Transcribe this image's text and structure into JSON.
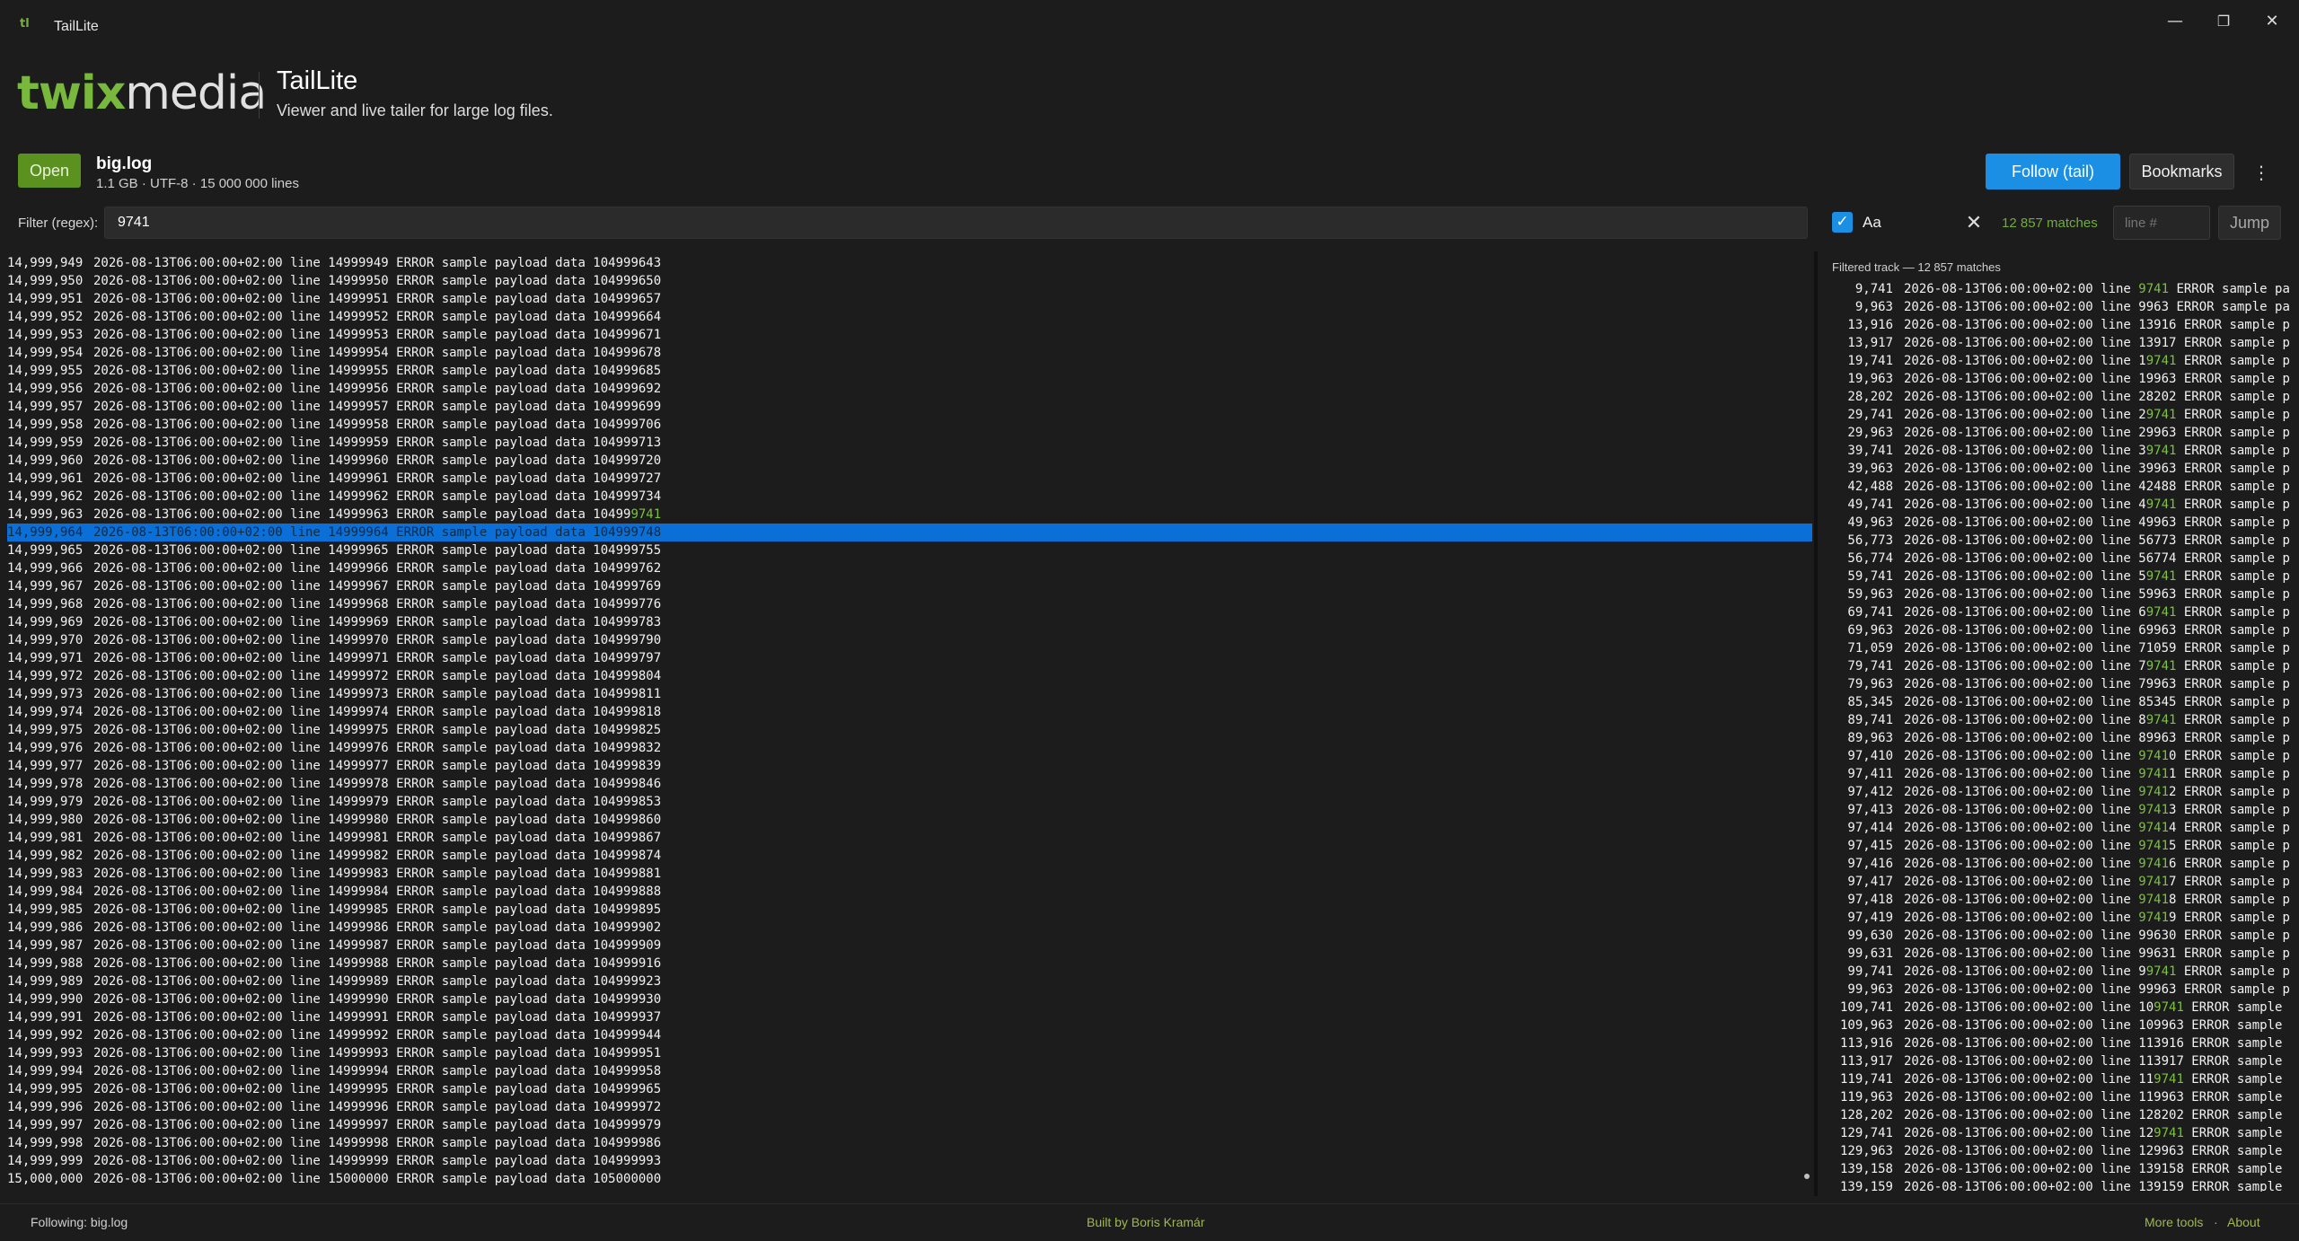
{
  "window": {
    "title": "TailLite",
    "app_icon_glyph": "tl",
    "minimize_glyph": "—",
    "restore_glyph": "❐",
    "close_glyph": "✕"
  },
  "header": {
    "logo_left": "twix",
    "logo_right": "media",
    "app_name": "TailLite",
    "tagline": "Viewer and live tailer for large log files."
  },
  "file": {
    "open_label": "Open",
    "name": "big.log",
    "meta": "1.1 GB · UTF-8 · 15 000 000 lines"
  },
  "toolbar": {
    "follow_label": "Follow (tail)",
    "bookmarks_label": "Bookmarks",
    "more_glyph": "⋮"
  },
  "filter": {
    "label": "Filter (regex):",
    "value": "9741",
    "case_label": "Aa",
    "case_checked": true,
    "clear_glyph": "✕",
    "match_count": "12 857 matches",
    "line_placeholder": "line #",
    "jump_label": "Jump"
  },
  "main_log": {
    "timestamp": "2026-08-13T06:00:00+02:00",
    "level": "ERROR",
    "selected_line": "14,999,964",
    "lines": [
      {
        "num": "14,999,949",
        "line": "14999949",
        "data": "104999643"
      },
      {
        "num": "14,999,950",
        "line": "14999950",
        "data": "104999650"
      },
      {
        "num": "14,999,951",
        "line": "14999951",
        "data": "104999657"
      },
      {
        "num": "14,999,952",
        "line": "14999952",
        "data": "104999664"
      },
      {
        "num": "14,999,953",
        "line": "14999953",
        "data": "104999671"
      },
      {
        "num": "14,999,954",
        "line": "14999954",
        "data": "104999678"
      },
      {
        "num": "14,999,955",
        "line": "14999955",
        "data": "104999685"
      },
      {
        "num": "14,999,956",
        "line": "14999956",
        "data": "104999692"
      },
      {
        "num": "14,999,957",
        "line": "14999957",
        "data": "104999699"
      },
      {
        "num": "14,999,958",
        "line": "14999958",
        "data": "104999706"
      },
      {
        "num": "14,999,959",
        "line": "14999959",
        "data": "104999713"
      },
      {
        "num": "14,999,960",
        "line": "14999960",
        "data": "104999720"
      },
      {
        "num": "14,999,961",
        "line": "14999961",
        "data": "104999727"
      },
      {
        "num": "14,999,962",
        "line": "14999962",
        "data": "104999734"
      },
      {
        "num": "14,999,963",
        "line": "14999963",
        "data": "104999741"
      },
      {
        "num": "14,999,964",
        "line": "14999964",
        "data": "104999748"
      },
      {
        "num": "14,999,965",
        "line": "14999965",
        "data": "104999755"
      },
      {
        "num": "14,999,966",
        "line": "14999966",
        "data": "104999762"
      },
      {
        "num": "14,999,967",
        "line": "14999967",
        "data": "104999769"
      },
      {
        "num": "14,999,968",
        "line": "14999968",
        "data": "104999776"
      },
      {
        "num": "14,999,969",
        "line": "14999969",
        "data": "104999783"
      },
      {
        "num": "14,999,970",
        "line": "14999970",
        "data": "104999790"
      },
      {
        "num": "14,999,971",
        "line": "14999971",
        "data": "104999797"
      },
      {
        "num": "14,999,972",
        "line": "14999972",
        "data": "104999804"
      },
      {
        "num": "14,999,973",
        "line": "14999973",
        "data": "104999811"
      },
      {
        "num": "14,999,974",
        "line": "14999974",
        "data": "104999818"
      },
      {
        "num": "14,999,975",
        "line": "14999975",
        "data": "104999825"
      },
      {
        "num": "14,999,976",
        "line": "14999976",
        "data": "104999832"
      },
      {
        "num": "14,999,977",
        "line": "14999977",
        "data": "104999839"
      },
      {
        "num": "14,999,978",
        "line": "14999978",
        "data": "104999846"
      },
      {
        "num": "14,999,979",
        "line": "14999979",
        "data": "104999853"
      },
      {
        "num": "14,999,980",
        "line": "14999980",
        "data": "104999860"
      },
      {
        "num": "14,999,981",
        "line": "14999981",
        "data": "104999867"
      },
      {
        "num": "14,999,982",
        "line": "14999982",
        "data": "104999874"
      },
      {
        "num": "14,999,983",
        "line": "14999983",
        "data": "104999881"
      },
      {
        "num": "14,999,984",
        "line": "14999984",
        "data": "104999888"
      },
      {
        "num": "14,999,985",
        "line": "14999985",
        "data": "104999895"
      },
      {
        "num": "14,999,986",
        "line": "14999986",
        "data": "104999902"
      },
      {
        "num": "14,999,987",
        "line": "14999987",
        "data": "104999909"
      },
      {
        "num": "14,999,988",
        "line": "14999988",
        "data": "104999916"
      },
      {
        "num": "14,999,989",
        "line": "14999989",
        "data": "104999923"
      },
      {
        "num": "14,999,990",
        "line": "14999990",
        "data": "104999930"
      },
      {
        "num": "14,999,991",
        "line": "14999991",
        "data": "104999937"
      },
      {
        "num": "14,999,992",
        "line": "14999992",
        "data": "104999944"
      },
      {
        "num": "14,999,993",
        "line": "14999993",
        "data": "104999951"
      },
      {
        "num": "14,999,994",
        "line": "14999994",
        "data": "104999958"
      },
      {
        "num": "14,999,995",
        "line": "14999995",
        "data": "104999965"
      },
      {
        "num": "14,999,996",
        "line": "14999996",
        "data": "104999972"
      },
      {
        "num": "14,999,997",
        "line": "14999997",
        "data": "104999979"
      },
      {
        "num": "14,999,998",
        "line": "14999998",
        "data": "104999986"
      },
      {
        "num": "14,999,999",
        "line": "14999999",
        "data": "104999993"
      },
      {
        "num": "15,000,000",
        "line": "15000000",
        "data": "105000000"
      }
    ]
  },
  "filtered": {
    "title": "Filtered track — 12 857 matches",
    "timestamp": "2026-08-13T06:00:00+02:00",
    "lines": [
      {
        "num": "9,741",
        "line": "9741",
        "tail": " ERROR sample pay"
      },
      {
        "num": "9,963",
        "line": "9963",
        "tail": " ERROR sample pay"
      },
      {
        "num": "13,916",
        "line": "13916",
        "tail": " ERROR sample pa"
      },
      {
        "num": "13,917",
        "line": "13917",
        "tail": " ERROR sample pa"
      },
      {
        "num": "19,741",
        "line": "19741",
        "tail": " ERROR sample pa"
      },
      {
        "num": "19,963",
        "line": "19963",
        "tail": " ERROR sample pa"
      },
      {
        "num": "28,202",
        "line": "28202",
        "tail": " ERROR sample pa"
      },
      {
        "num": "29,741",
        "line": "29741",
        "tail": " ERROR sample pa"
      },
      {
        "num": "29,963",
        "line": "29963",
        "tail": " ERROR sample pa"
      },
      {
        "num": "39,741",
        "line": "39741",
        "tail": " ERROR sample pa"
      },
      {
        "num": "39,963",
        "line": "39963",
        "tail": " ERROR sample pa"
      },
      {
        "num": "42,488",
        "line": "42488",
        "tail": " ERROR sample pa"
      },
      {
        "num": "49,741",
        "line": "49741",
        "tail": " ERROR sample pa"
      },
      {
        "num": "49,963",
        "line": "49963",
        "tail": " ERROR sample pa"
      },
      {
        "num": "56,773",
        "line": "56773",
        "tail": " ERROR sample pa"
      },
      {
        "num": "56,774",
        "line": "56774",
        "tail": " ERROR sample pa"
      },
      {
        "num": "59,741",
        "line": "59741",
        "tail": " ERROR sample pa"
      },
      {
        "num": "59,963",
        "line": "59963",
        "tail": " ERROR sample pa"
      },
      {
        "num": "69,741",
        "line": "69741",
        "tail": " ERROR sample pa"
      },
      {
        "num": "69,963",
        "line": "69963",
        "tail": " ERROR sample pa"
      },
      {
        "num": "71,059",
        "line": "71059",
        "tail": " ERROR sample pa"
      },
      {
        "num": "79,741",
        "line": "79741",
        "tail": " ERROR sample pa"
      },
      {
        "num": "79,963",
        "line": "79963",
        "tail": " ERROR sample pa"
      },
      {
        "num": "85,345",
        "line": "85345",
        "tail": " ERROR sample pa"
      },
      {
        "num": "89,741",
        "line": "89741",
        "tail": " ERROR sample pa"
      },
      {
        "num": "89,963",
        "line": "89963",
        "tail": " ERROR sample pa"
      },
      {
        "num": "97,410",
        "line": "97410",
        "tail": " ERROR sample pa"
      },
      {
        "num": "97,411",
        "line": "97411",
        "tail": " ERROR sample pa"
      },
      {
        "num": "97,412",
        "line": "97412",
        "tail": " ERROR sample pa"
      },
      {
        "num": "97,413",
        "line": "97413",
        "tail": " ERROR sample pa"
      },
      {
        "num": "97,414",
        "line": "97414",
        "tail": " ERROR sample pa"
      },
      {
        "num": "97,415",
        "line": "97415",
        "tail": " ERROR sample pa"
      },
      {
        "num": "97,416",
        "line": "97416",
        "tail": " ERROR sample pa"
      },
      {
        "num": "97,417",
        "line": "97417",
        "tail": " ERROR sample pa"
      },
      {
        "num": "97,418",
        "line": "97418",
        "tail": " ERROR sample pa"
      },
      {
        "num": "97,419",
        "line": "97419",
        "tail": " ERROR sample pa"
      },
      {
        "num": "99,630",
        "line": "99630",
        "tail": " ERROR sample pa"
      },
      {
        "num": "99,631",
        "line": "99631",
        "tail": " ERROR sample pa"
      },
      {
        "num": "99,741",
        "line": "99741",
        "tail": " ERROR sample pa"
      },
      {
        "num": "99,963",
        "line": "99963",
        "tail": " ERROR sample pa"
      },
      {
        "num": "109,741",
        "line": "109741",
        "tail": " ERROR sample p"
      },
      {
        "num": "109,963",
        "line": "109963",
        "tail": " ERROR sample p"
      },
      {
        "num": "113,916",
        "line": "113916",
        "tail": " ERROR sample p"
      },
      {
        "num": "113,917",
        "line": "113917",
        "tail": " ERROR sample p"
      },
      {
        "num": "119,741",
        "line": "119741",
        "tail": " ERROR sample p"
      },
      {
        "num": "119,963",
        "line": "119963",
        "tail": " ERROR sample p"
      },
      {
        "num": "128,202",
        "line": "128202",
        "tail": " ERROR sample p"
      },
      {
        "num": "129,741",
        "line": "129741",
        "tail": " ERROR sample p"
      },
      {
        "num": "129,963",
        "line": "129963",
        "tail": " ERROR sample p"
      },
      {
        "num": "139,158",
        "line": "139158",
        "tail": " ERROR sample p"
      },
      {
        "num": "139,159",
        "line": "139159",
        "tail": " ERROR sample p"
      }
    ]
  },
  "footer": {
    "status": "Following: big.log",
    "credit": "Built by Boris Kramár",
    "more_tools": "More tools",
    "separator": "·",
    "about": "About"
  },
  "colors": {
    "accent_blue": "#1a8fe3",
    "brand_green": "#78b83c",
    "match_green": "#7dc142",
    "background": "#1c1c1c"
  }
}
